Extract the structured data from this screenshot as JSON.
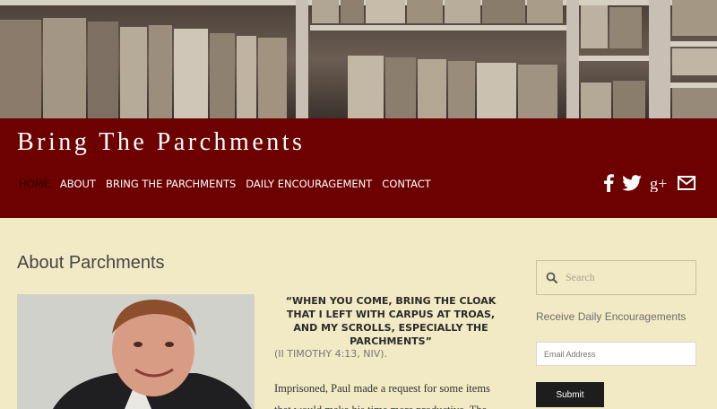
{
  "header": {
    "site_title": "Bring The Parchments",
    "nav": [
      {
        "label": "HOME",
        "active": true
      },
      {
        "label": "ABOUT",
        "active": false
      },
      {
        "label": "BRING THE PARCHMENTS",
        "active": false
      },
      {
        "label": "DAILY ENCOURAGEMENT",
        "active": false
      },
      {
        "label": "CONTACT",
        "active": false
      }
    ],
    "social": [
      "facebook-icon",
      "twitter-icon",
      "google-plus-icon",
      "mail-icon"
    ],
    "band_color": "#6d0000"
  },
  "main": {
    "page_title": "About Parchments",
    "quote": "“WHEN YOU COME, BRING THE CLOAK THAT I LEFT WITH CARPUS AT TROAS, AND MY SCROLLS, ESPECIALLY THE PARCHMENTS”",
    "citation": "(II TIMOTHY 4:13, NIV).",
    "body": "Imprisoned, Paul made a request for some items that would make his time more productive.  The"
  },
  "sidebar": {
    "search_placeholder": "Search",
    "subscribe_title": "Receive Daily Encouragements",
    "email_placeholder": "Email Address",
    "submit_label": "Submit"
  },
  "colors": {
    "background": "#f2eac4",
    "header_band": "#6d0000",
    "active_nav": "#2b0000",
    "button": "#1d1d1d"
  }
}
